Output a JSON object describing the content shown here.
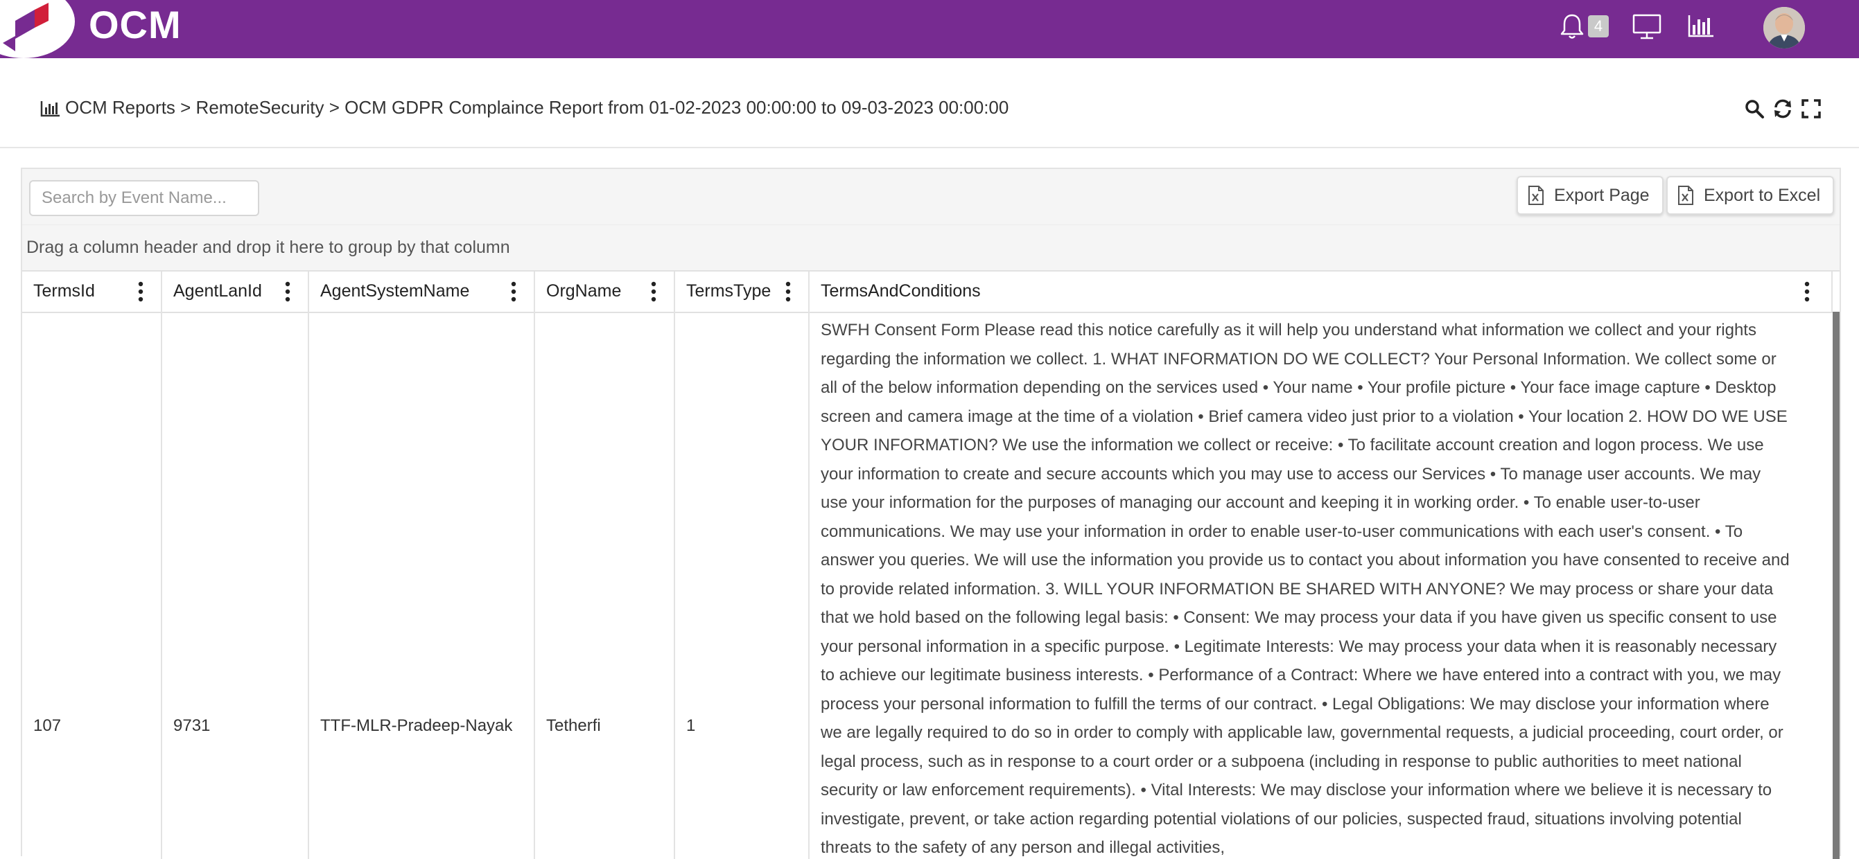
{
  "app": {
    "title": "OCM",
    "notification_count": "4"
  },
  "icons": {
    "notifications": "bell-icon",
    "monitor": "monitor-icon",
    "reports": "bar-chart-icon",
    "breadcrumb": "report-chart-icon",
    "search": "search-icon",
    "refresh": "refresh-icon",
    "fullscreen": "fullscreen-icon",
    "excel": "excel-file-icon",
    "column_menu": "kebab-menu-icon"
  },
  "colors": {
    "header": "#772b91",
    "accent": "#772b91",
    "logo_red": "#d11f3a"
  },
  "breadcrumb": "OCM Reports > RemoteSecurity > OCM GDPR Complaince Report from 01-02-2023 00:00:00 to 09-03-2023 00:00:00",
  "toolbar": {
    "search_placeholder": "Search by Event Name...",
    "export_page": "Export Page",
    "export_excel": "Export to Excel"
  },
  "group_hint": "Drag a column header and drop it here to group by that column",
  "columns": [
    "TermsId",
    "AgentLanId",
    "AgentSystemName",
    "OrgName",
    "TermsType",
    "TermsAndConditions"
  ],
  "rows": [
    {
      "TermsId": "107",
      "AgentLanId": "9731",
      "AgentSystemName": "TTF-MLR-Pradeep-Nayak",
      "OrgName": "Tetherfi",
      "TermsType": "1",
      "TermsAndConditions": "SWFH Consent Form Please read this notice carefully as it will help you understand what information we collect and your rights regarding the information we collect. 1. WHAT INFORMATION DO WE COLLECT? Your Personal Information. We collect some or all of the below information depending on the services used • Your name • Your profile picture • Your face image capture • Desktop screen and camera image at the time of a violation • Brief camera video just prior to a violation • Your location 2. HOW DO WE USE YOUR INFORMATION? We use the information we collect or receive: • To facilitate account creation and logon process. We use your information to create and secure accounts which you may use to access our Services • To manage user accounts. We may use your information for the purposes of managing our account and keeping it in working order. • To enable user-to-user communications. We may use your information in order to enable user-to-user communications with each user's consent. • To answer you queries. We will use the information you provide us to contact you about information you have consented to receive and to provide related information. 3. WILL YOUR INFORMATION BE SHARED WITH ANYONE? We may process or share your data that we hold based on the following legal basis: • Consent: We may process your data if you have given us specific consent to use your personal information in a specific purpose. • Legitimate Interests: We may process your data when it is reasonably necessary to achieve our legitimate business interests. • Performance of a Contract: Where we have entered into a contract with you, we may process your personal information to fulfill the terms of our contract. • Legal Obligations: We may disclose your information where we are legally required to do so in order to comply with applicable law, governmental requests, a judicial proceeding, court order, or legal process, such as in response to a court order or a subpoena (including in response to public authorities to meet national security or law enforcement requirements). • Vital Interests: We may disclose your information where we believe it is necessary to investigate, prevent, or take action regarding potential violations of our policies, suspected fraud, situations involving potential threats to the safety of any person and illegal activities,"
    }
  ]
}
